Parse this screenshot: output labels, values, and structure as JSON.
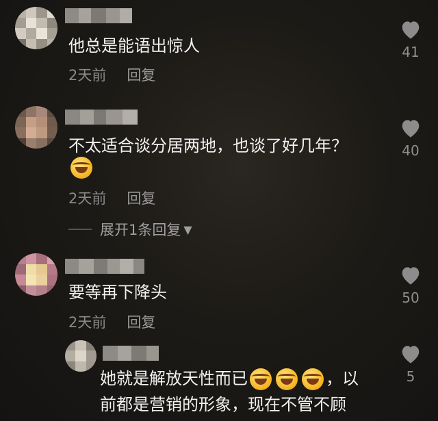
{
  "comments": [
    {
      "text": "他总是能语出惊人",
      "time": "2天前",
      "reply": "回复",
      "likes": "41",
      "icons": {
        "like": "heart-icon",
        "avatar": "pixelated-avatar"
      }
    },
    {
      "text": "不太适合谈分居两地，也谈了好几年？",
      "emoji": "laughing-crying-emoji",
      "time": "2天前",
      "reply": "回复",
      "likes": "40",
      "expand_replies": "展开1条回复"
    },
    {
      "text": "要等再下降头",
      "time": "2天前",
      "reply": "回复",
      "likes": "50"
    },
    {
      "text_line1": "她就是解放天性而已",
      "text_line1_suffix": "，以",
      "text_line2": "前都是营销的形象，现在不管不顾",
      "emoji_count": 3,
      "likes": "5"
    }
  ],
  "colors": {
    "text": "#f1f1f1",
    "meta": "#8a8a8a",
    "heart": "#8c8c8c"
  }
}
